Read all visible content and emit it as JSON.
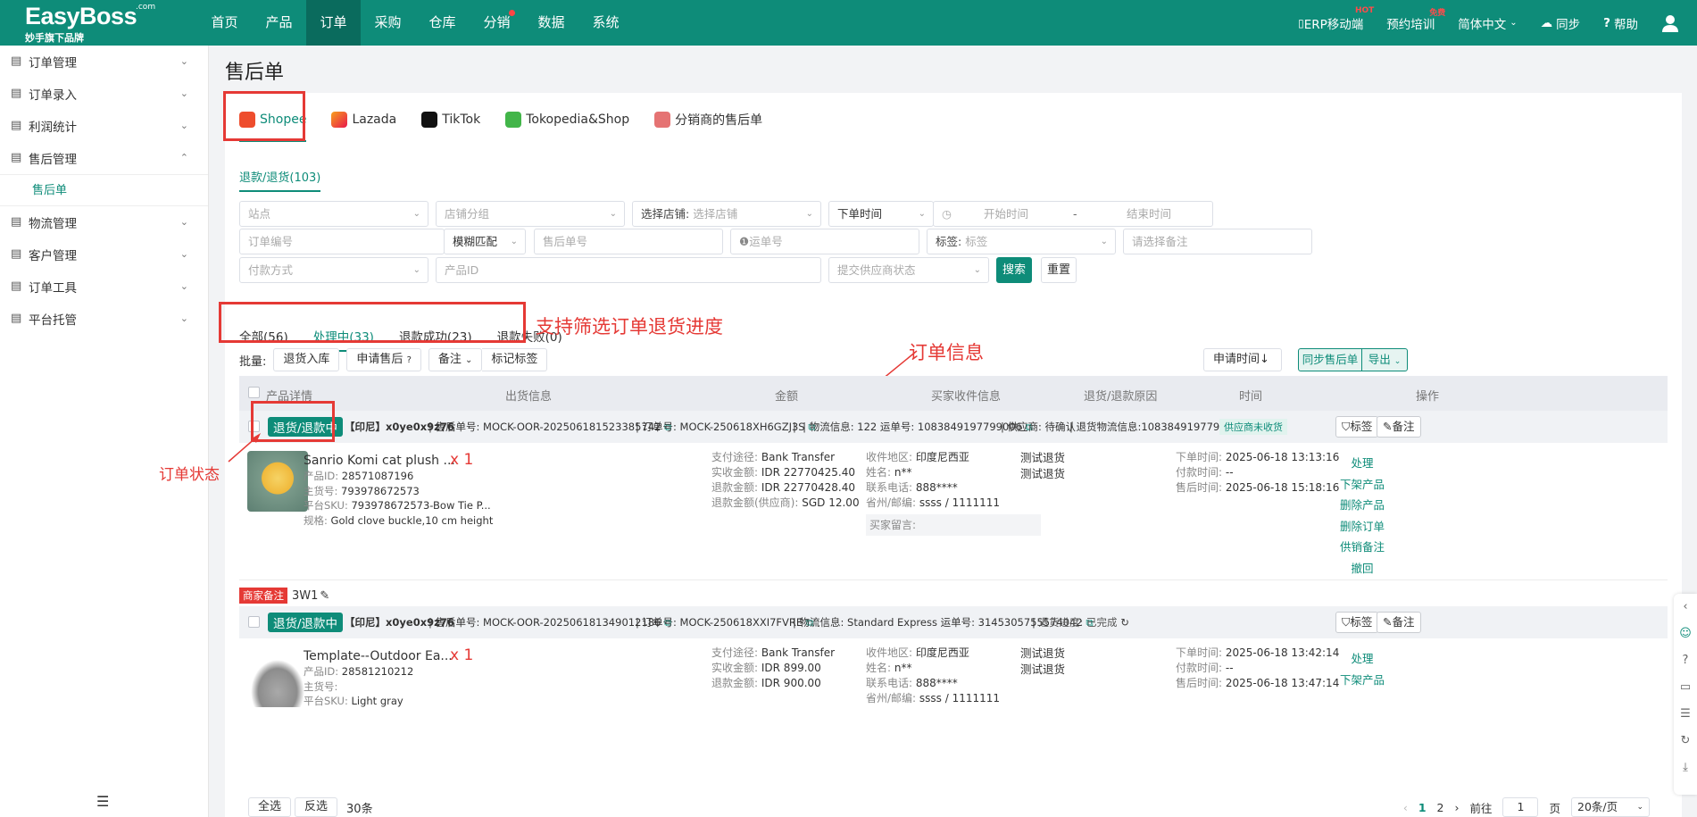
{
  "header": {
    "logo": "EasyBoss",
    "logo_com": ".com",
    "logo_sub": "妙手旗下品牌",
    "nav": [
      "首页",
      "产品",
      "订单",
      "采购",
      "仓库",
      "分销",
      "数据",
      "系统"
    ],
    "right": [
      {
        "label": "ERP移动端",
        "badge": "HOT"
      },
      {
        "label": "预约培训",
        "badge": "免费"
      },
      {
        "label": "简体中文",
        "badge": ""
      },
      {
        "label": "同步",
        "badge": ""
      },
      {
        "label": "帮助",
        "badge": ""
      }
    ]
  },
  "sidebar": {
    "items": [
      "订单管理",
      "订单录入",
      "利润统计",
      "售后管理",
      "物流管理",
      "客户管理",
      "订单工具",
      "平台托管"
    ],
    "sub_active": "售后单"
  },
  "page": {
    "title": "售后单",
    "shop_tabs": [
      "Shopee",
      "Lazada",
      "TikTok",
      "Tokopedia&Shop",
      "分销商的售后单"
    ],
    "sub_tab": "退款/退货(103)"
  },
  "filters": {
    "site": "站点",
    "shop_group": "店铺分组",
    "choose_shop_label": "选择店铺:",
    "choose_shop": "选择店铺",
    "order_time": "下单时间",
    "start_time": "开始时间",
    "date_sep": "-",
    "end_time": "结束时间",
    "order_no": "订单编号",
    "fuzzy": "模糊匹配",
    "aftersale_no": "售后单号",
    "waybill": "运单号",
    "tag_label": "标签:",
    "tag": "标签",
    "remark": "请选择备注",
    "payment": "付款方式",
    "product_id": "产品ID",
    "supplier_status": "提交供应商状态",
    "search": "搜索",
    "reset": "重置"
  },
  "status_tabs": [
    "全部(56)",
    "处理中(33)",
    "退款成功(23)",
    "退款失败(0)"
  ],
  "annotations": {
    "filter_note": "支持筛选订单退货进度",
    "order_info": "订单信息",
    "order_status": "订单状态"
  },
  "toolbar": {
    "batch_label": "批量:",
    "buttons": [
      "退货入库",
      "申请售后",
      "备注",
      "标记标签"
    ],
    "sort": "申请时间↓",
    "sync": "同步售后单",
    "export": "导出"
  },
  "table_headers": [
    "产品详情",
    "出货信息",
    "金额",
    "买家收件信息",
    "退货/退款原因",
    "时间",
    "操作"
  ],
  "orders": [
    {
      "status": "退货/退款中",
      "shop": "【印尼】x0ye0x9z76",
      "aftersale": "售后单号: MOCK-OOR-202506181523385742",
      "order": "订单号: MOCK-250618XH6GZJ3S",
      "logistics": "物流信息: 122 运单号: 1083849197799006",
      "supplier": "供应商: 待确认",
      "return_logistics": "退货物流信息:1083849197799006",
      "supplier_tag": "供应商未收货",
      "tag_btn": "标签",
      "remark_btn": "备注",
      "product_name": "Sanrio Komi cat plush ...",
      "qty": "x 1",
      "product_id_k": "产品ID:",
      "product_id": "28571087196",
      "main_sku_k": "主货号:",
      "main_sku": "793978672573",
      "platform_sku_k": "平台SKU:",
      "platform_sku": "793978672573-Bow Tie P...",
      "spec_k": "规格:",
      "spec": "Gold clove buckle,10 cm height",
      "pay_k": "支付途径:",
      "pay": "Bank Transfer",
      "received_k": "实收金额:",
      "received": "IDR 22770425.40",
      "refund_k": "退款金额:",
      "refund": "IDR 22770428.40",
      "refund_sup_k": "退款金额(供应商):",
      "refund_sup": "SGD 12.00",
      "region_k": "收件地区:",
      "region": "印度尼西亚",
      "name_k": "姓名:",
      "name": "n**",
      "phone_k": "联系电话:",
      "phone": "888****",
      "zip_k": "省州/邮编:",
      "zip": "ssss / 1111111",
      "buyer_msg_k": "买家留言:",
      "reason1": "测试退货",
      "reason2": "测试退货",
      "order_time_k": "下单时间:",
      "order_time": "2025-06-18 13:13:16",
      "pay_time_k": "付款时间:",
      "pay_time": "--",
      "as_time_k": "售后时间:",
      "as_time": "2025-06-18 15:18:16",
      "actions": [
        "处理",
        "下架产品",
        "删除产品",
        "删除订单",
        "供销备注",
        "撤回"
      ],
      "note_tag": "商家备注",
      "note": "3W1"
    },
    {
      "status": "退货/退款中",
      "shop": "【印尼】x0ye0x9z76",
      "aftersale": "售后单号: MOCK-OOR-202506181349012186",
      "order": "订单号: MOCK-250618XXI7FVRE",
      "logistics": "物流信息: Standard Express 运单号: 3145305755574042",
      "return_progress": "退货进度: 已完成",
      "tag_btn": "标签",
      "remark_btn": "备注",
      "product_name": "Template--Outdoor Ea...",
      "qty": "x 1",
      "product_id_k": "产品ID:",
      "product_id": "28581210212",
      "main_sku_k": "主货号:",
      "main_sku": "",
      "platform_sku_k": "平台SKU:",
      "platform_sku": "Light gray",
      "pay_k": "支付途径:",
      "pay": "Bank Transfer",
      "received_k": "实收金额:",
      "received": "IDR 899.00",
      "refund_k": "退款金额:",
      "refund": "IDR 900.00",
      "region_k": "收件地区:",
      "region": "印度尼西亚",
      "name_k": "姓名:",
      "name": "n**",
      "phone_k": "联系电话:",
      "phone": "888****",
      "zip_k": "省州/邮编:",
      "zip": "ssss / 1111111",
      "reason1": "测试退货",
      "reason2": "测试退货",
      "order_time_k": "下单时间:",
      "order_time": "2025-06-18 13:42:14",
      "pay_time_k": "付款时间:",
      "pay_time": "--",
      "as_time_k": "售后时间:",
      "as_time": "2025-06-18 13:47:14",
      "actions": [
        "处理",
        "下架产品"
      ]
    }
  ],
  "footer": {
    "select_all": "全选",
    "invert": "反选",
    "count": "30条",
    "pages": [
      "1",
      "2"
    ],
    "goto": "前往",
    "page_input": "1",
    "page_unit": "页",
    "page_size": "20条/页"
  }
}
